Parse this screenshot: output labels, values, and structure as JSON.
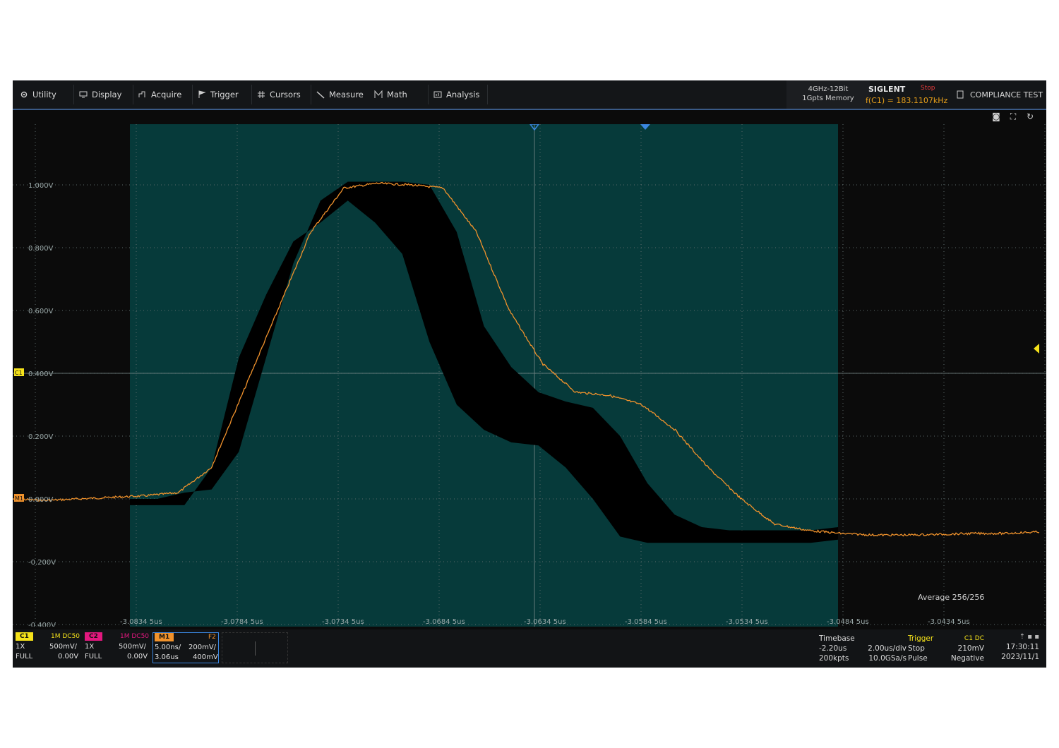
{
  "menu": {
    "items": [
      {
        "label": "Utility",
        "icon": "gear-icon"
      },
      {
        "label": "Display",
        "icon": "monitor-icon"
      },
      {
        "label": "Acquire",
        "icon": "acquire-icon"
      },
      {
        "label": "Trigger",
        "icon": "flag-icon"
      },
      {
        "label": "Cursors",
        "icon": "grid-icon"
      },
      {
        "label": "Measure",
        "icon": "ruler-icon"
      },
      {
        "label": "Math",
        "icon": "math-icon"
      },
      {
        "label": "Analysis",
        "icon": "analysis-icon"
      }
    ]
  },
  "header": {
    "bandwidth": "4GHz-12Bit",
    "memory": "1Gpts Memory",
    "brand": "SIGLENT",
    "run_state": "Stop",
    "frequency": "f(C1) = 183.1107kHz",
    "compliance": "COMPLIANCE TEST"
  },
  "colors": {
    "waveform": "#f0922c",
    "envelope": "#000000",
    "zone": "#063a3a",
    "grid": "#5c6b6b",
    "c1": "#f5e21a",
    "c2": "#e2187f",
    "m1": "#f0922c",
    "accent_blue": "#3a86e0"
  },
  "chart_data": {
    "type": "line",
    "y_tick_labels": [
      "1.000V",
      "0.800V",
      "0.600V",
      "0.400V",
      "0.200V",
      "0.000V",
      "-0.200V",
      "-0.400V"
    ],
    "x_tick_labels": [
      "-3.0834 5us",
      "-3.0784 5us",
      "-3.0734 5us",
      "-3.0684 5us",
      "-3.0634 5us",
      "-3.0584 5us",
      "-3.0534 5us",
      "-3.0484 5us",
      "-3.0434 5us"
    ],
    "channel_markers": {
      "c1": "C1",
      "m1": "M1"
    },
    "average_label": "Average 256/256",
    "ylim": [
      -0.4,
      1.2
    ],
    "waveform_values": [
      0.0,
      -0.005,
      0.0,
      0.005,
      0.01,
      0.02,
      0.1,
      0.35,
      0.6,
      0.85,
      0.99,
      1.005,
      1.0,
      0.99,
      0.85,
      0.6,
      0.43,
      0.34,
      0.33,
      0.3,
      0.22,
      0.1,
      0.0,
      -0.08,
      -0.1,
      -0.11,
      -0.115,
      -0.115,
      -0.113,
      -0.11,
      -0.11,
      -0.105
    ],
    "envelope_upper": [
      0.0,
      0.0,
      0.02,
      0.03,
      0.15,
      0.45,
      0.75,
      0.95,
      1.01,
      1.01,
      1.01,
      1.0,
      0.85,
      0.55,
      0.42,
      0.34,
      0.31,
      0.29,
      0.2,
      0.05,
      -0.05,
      -0.09,
      -0.1,
      -0.1,
      -0.1,
      -0.1,
      -0.09
    ],
    "envelope_lower": [
      -0.02,
      -0.02,
      -0.02,
      0.1,
      0.45,
      0.65,
      0.82,
      0.88,
      0.95,
      0.88,
      0.78,
      0.5,
      0.3,
      0.22,
      0.18,
      0.17,
      0.1,
      0.0,
      -0.12,
      -0.14,
      -0.14,
      -0.14,
      -0.14,
      -0.14,
      -0.14,
      -0.14,
      -0.13
    ]
  },
  "bottom": {
    "c1": {
      "tag": "C1",
      "coupling": "1M DC50",
      "probe": "1X",
      "scale": "500mV/",
      "bw": "FULL",
      "offset": "0.00V"
    },
    "c2": {
      "tag": "C2",
      "coupling": "1M DC50",
      "probe": "1X",
      "scale": "500mV/",
      "bw": "FULL",
      "offset": "0.00V"
    },
    "m1": {
      "tag": "M1",
      "func": "F2",
      "hscale": "5.00ns/",
      "vscale": "200mV/",
      "hpos": "3.06us",
      "vpos": "400mV"
    },
    "timebase": {
      "title": "Timebase",
      "delay": "-2.20us",
      "div": "2.00us/div",
      "points": "200kpts",
      "rate": "10.0GSa/s"
    },
    "trigger": {
      "title": "Trigger",
      "source": "C1 DC",
      "state": "Stop",
      "level": "210mV",
      "type": "Pulse",
      "slope": "Negative"
    },
    "clock": {
      "time": "17:30:11",
      "date": "2023/11/1"
    }
  }
}
